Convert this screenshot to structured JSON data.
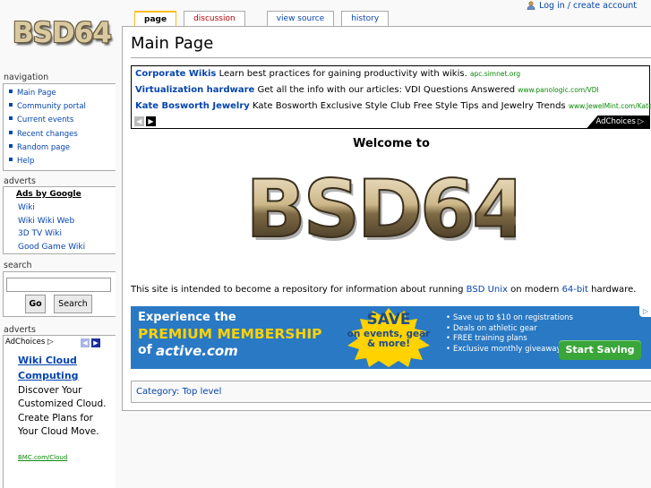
{
  "personal_tools": {
    "login": "Log in / create account"
  },
  "logo": {
    "text": "BSD64"
  },
  "tabs": [
    {
      "label": "page",
      "state": "selected"
    },
    {
      "label": "discussion",
      "state": "new"
    },
    {
      "label": "view source",
      "state": "normal"
    },
    {
      "label": "history",
      "state": "normal"
    }
  ],
  "page": {
    "title": "Main Page",
    "welcome": "Welcome to",
    "logo_text": "BSD64",
    "intro": {
      "before": "This site is intended to become a repository for information about running ",
      "link1": "BSD",
      "space": " ",
      "link2": "Unix",
      "middle": " on modern ",
      "link3": "64-bit",
      "after": " hardware."
    },
    "category": {
      "label": "Category",
      "sep": ":",
      "value": "Top level"
    }
  },
  "text_ads": {
    "items": [
      {
        "title": "Corporate Wikis",
        "text": "Learn best practices for gaining productivity with wikis.",
        "url": "apc.simnet.org"
      },
      {
        "title": "Virtualization hardware",
        "text": "Get all the info with our articles: VDI Questions Answered",
        "url": "www.panologic.com/VDI"
      },
      {
        "title": "Kate Bosworth Jewelry",
        "text": "Kate Bosworth Exclusive Style Club Free Style Tips and Jewelry Trends",
        "url": "www.JewelMint.com/Kate"
      }
    ],
    "adchoices": "AdChoices"
  },
  "banner": {
    "line1": "Experience the",
    "line2": "PREMIUM MEMBERSHIP",
    "line3_prefix": "of",
    "brand": "active.com",
    "save": "SAVE",
    "save_sub": "on events, gear & more!",
    "bullets": [
      "Save up to $10 on registrations",
      "Deals on athletic gear",
      "FREE training plans",
      "Exclusive monthly giveaways"
    ],
    "cta": "Start Saving"
  },
  "sidebar": {
    "navigation_heading": "navigation",
    "navigation": [
      "Main Page",
      "Community portal",
      "Current events",
      "Recent changes",
      "Random page",
      "Help"
    ],
    "adverts_heading": "adverts",
    "adverts_header": "Ads by Google",
    "adverts_links": [
      "Wiki",
      "Wiki Wiki Web",
      "3D TV Wiki",
      "Good Game Wiki"
    ],
    "search_heading": "search",
    "search_input_value": "",
    "go_label": "Go",
    "search_label": "Search",
    "adverts2_heading": "adverts",
    "adchoices": "AdChoices",
    "ad": {
      "title": "Wiki Cloud Computing",
      "body": "Discover Your Customized Cloud. Create Plans for Your Cloud Move.",
      "url": "BMC.com/Cloud"
    }
  },
  "colors": {
    "link": "#0645ad",
    "new_link": "#ba0000",
    "ad_url": "#0a8a0a",
    "banner_bg": "#2a79c4",
    "tab_accent": "#fabd23"
  }
}
